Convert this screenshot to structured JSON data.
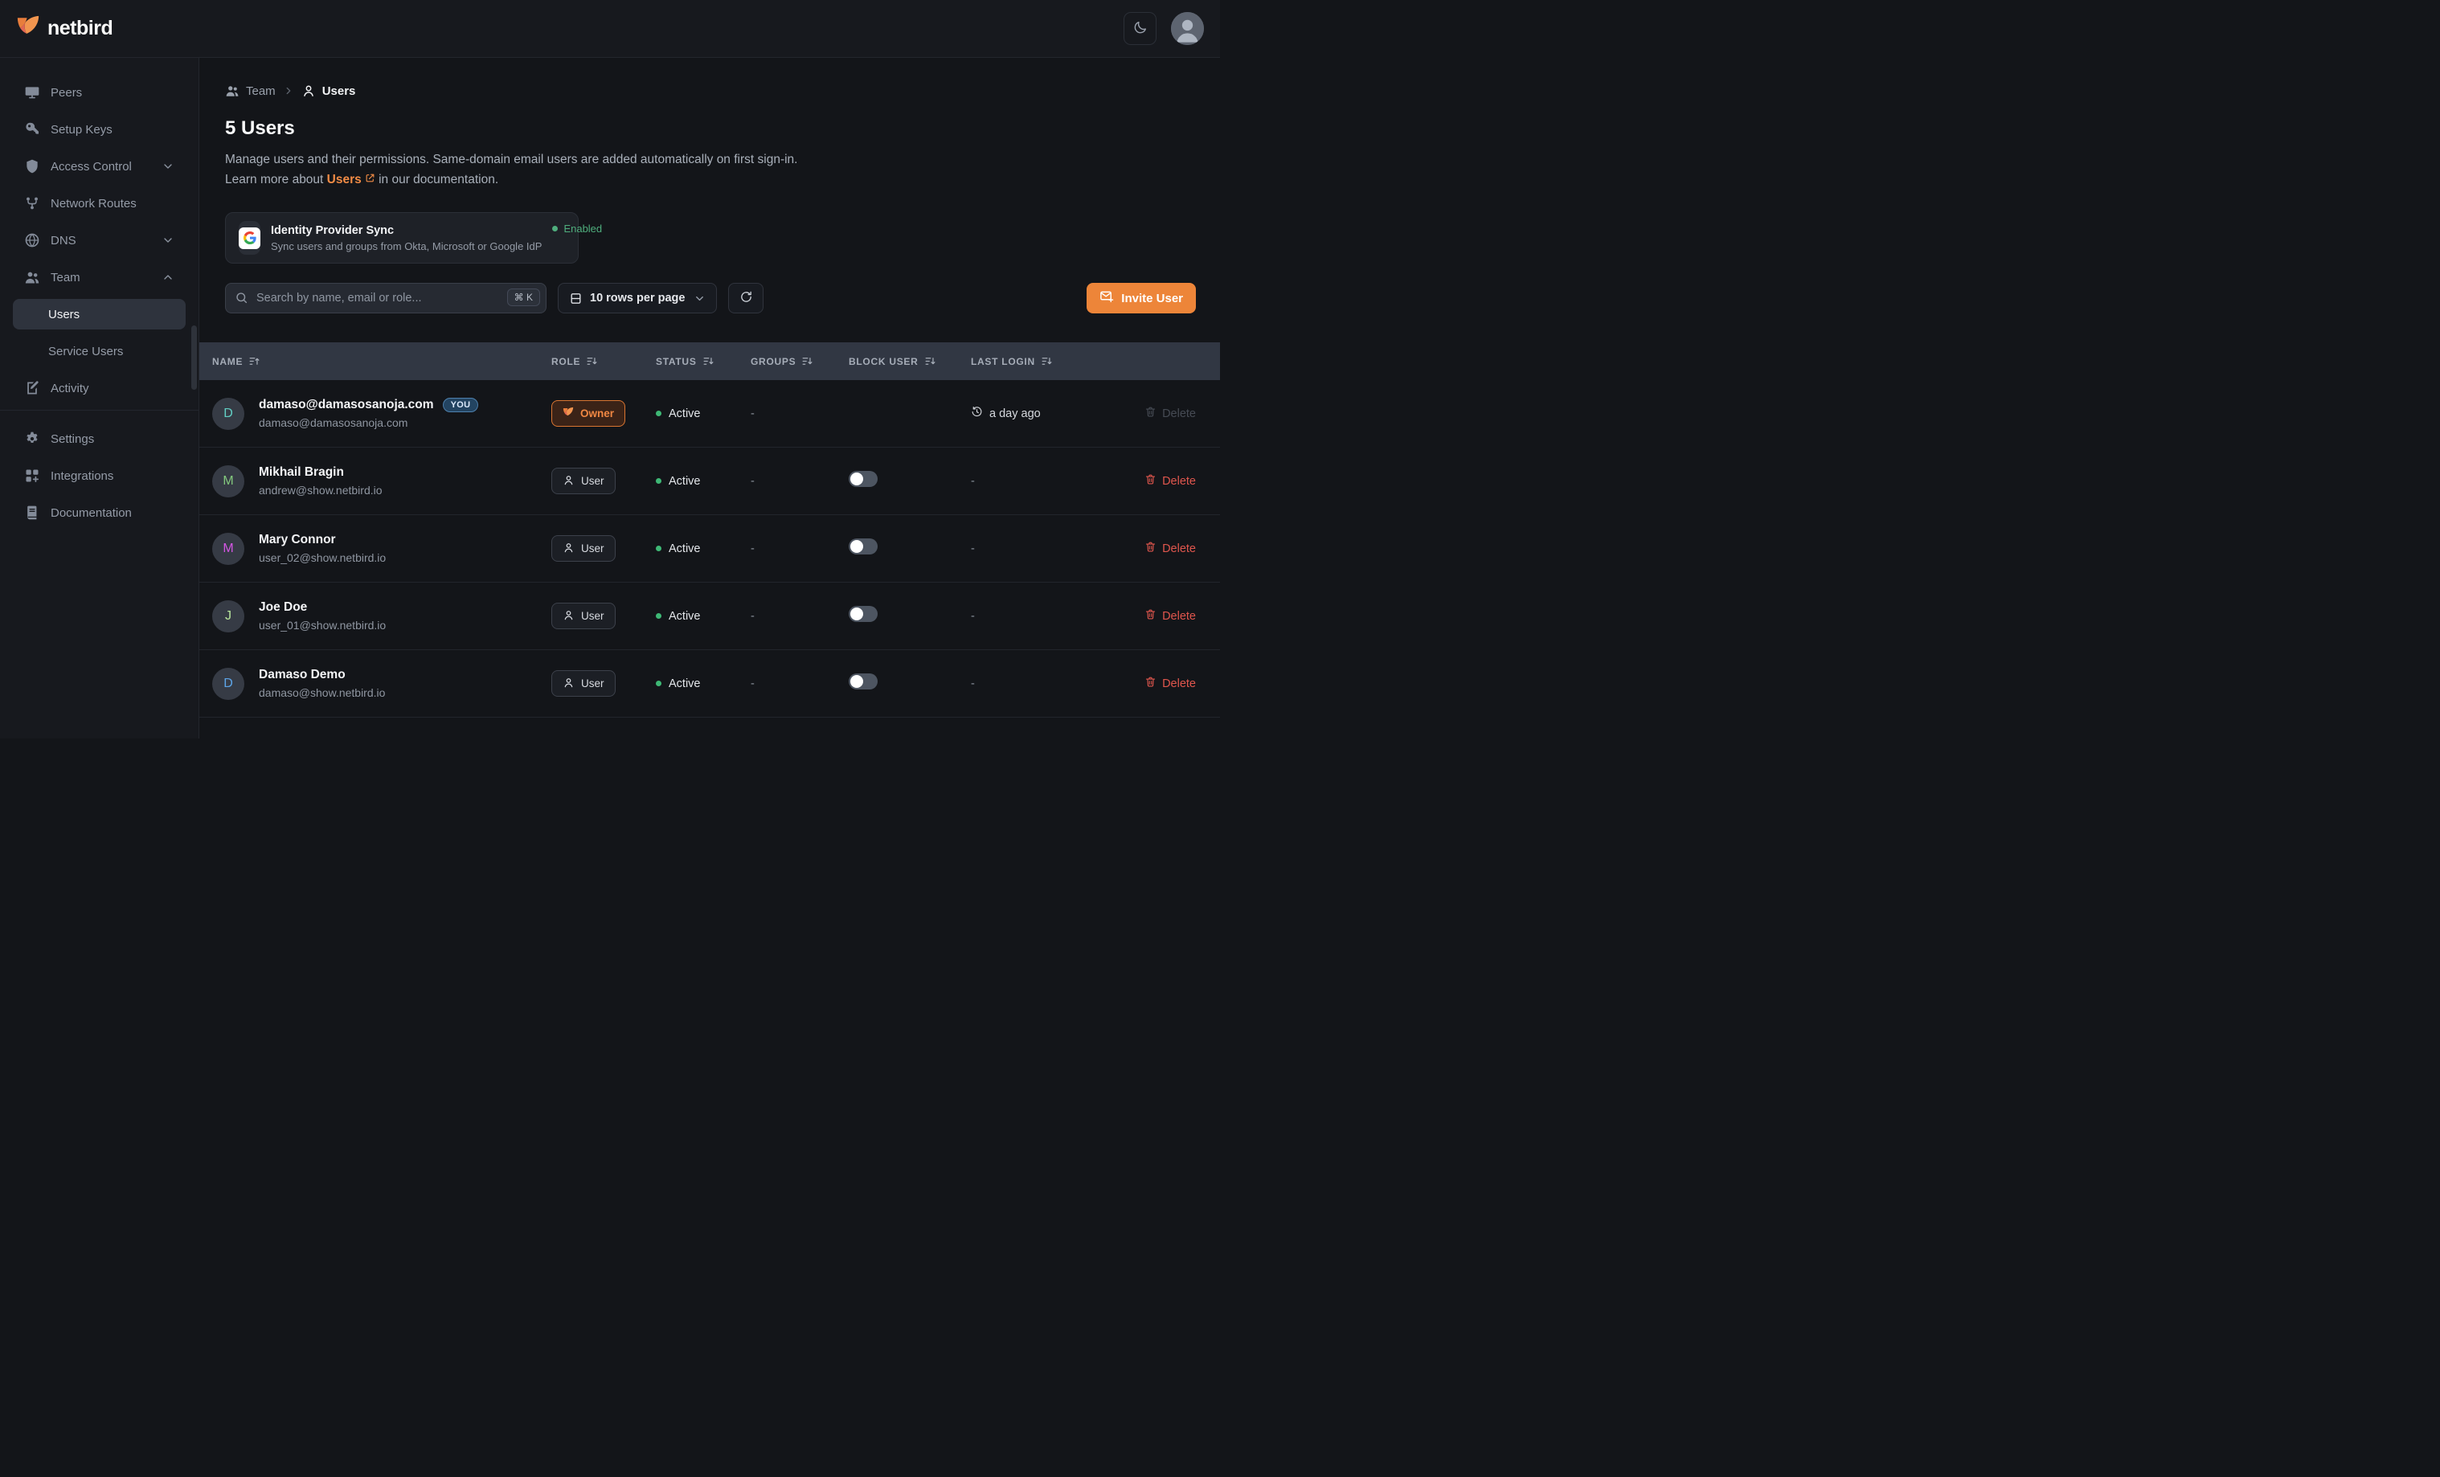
{
  "header": {
    "brand": "netbird"
  },
  "colors": {
    "accent": "#ed8539",
    "green": "#3eb875",
    "danger": "#e0564d",
    "owner_orange": "#ef8743"
  },
  "sidebar": {
    "items": [
      {
        "label": "Peers",
        "icon": "monitor-icon"
      },
      {
        "label": "Setup Keys",
        "icon": "key-icon"
      },
      {
        "label": "Access Control",
        "icon": "shield-icon",
        "chevron": "down"
      },
      {
        "label": "Network Routes",
        "icon": "routes-icon"
      },
      {
        "label": "DNS",
        "icon": "globe-icon",
        "chevron": "down"
      },
      {
        "label": "Team",
        "icon": "team-icon",
        "chevron": "up",
        "children": [
          {
            "label": "Users",
            "active": true
          },
          {
            "label": "Service Users",
            "active": false
          }
        ]
      },
      {
        "label": "Activity",
        "icon": "activity-icon"
      }
    ],
    "footer_items": [
      {
        "label": "Settings",
        "icon": "gear-icon"
      },
      {
        "label": "Integrations",
        "icon": "integrations-icon"
      },
      {
        "label": "Documentation",
        "icon": "docs-icon"
      }
    ]
  },
  "breadcrumb": {
    "team": "Team",
    "users": "Users"
  },
  "page": {
    "title": "5 Users",
    "description": "Manage users and their permissions. Same-domain email users are added automatically on first sign-in.",
    "learn_prefix": "Learn more about",
    "learn_link": "Users",
    "learn_suffix": "in our documentation."
  },
  "idp_card": {
    "title": "Identity Provider Sync",
    "subtitle": "Sync users and groups from Okta, Microsoft or Google IdP",
    "status": "Enabled"
  },
  "controls": {
    "search_placeholder": "Search by name, email or role...",
    "shortcut": "⌘ K",
    "rows_per_page": "10 rows per page",
    "invite": "Invite User"
  },
  "table": {
    "columns": [
      {
        "label": "NAME",
        "sort": "up"
      },
      {
        "label": "ROLE",
        "sort": "down"
      },
      {
        "label": "STATUS",
        "sort": "down"
      },
      {
        "label": "GROUPS",
        "sort": "down"
      },
      {
        "label": "BLOCK USER",
        "sort": "down"
      },
      {
        "label": "LAST LOGIN",
        "sort": "down"
      }
    ],
    "rows": [
      {
        "initial": "D",
        "initial_color": "#62cfc4",
        "name": "damaso@damasosanoja.com",
        "you_badge": "YOU",
        "email": "damaso@damasosanoja.com",
        "role": "Owner",
        "role_variant": "owner",
        "status": "Active",
        "groups": "-",
        "has_toggle": false,
        "last_login": "a day ago",
        "last_login_icon": true,
        "delete_label": "Delete",
        "delete_disabled": true
      },
      {
        "initial": "M",
        "initial_color": "#83c87d",
        "name": "Mikhail Bragin",
        "you_badge": null,
        "email": "andrew@show.netbird.io",
        "role": "User",
        "role_variant": "user",
        "status": "Active",
        "groups": "-",
        "has_toggle": true,
        "last_login": "-",
        "last_login_icon": false,
        "delete_label": "Delete",
        "delete_disabled": false
      },
      {
        "initial": "M",
        "initial_color": "#d356e3",
        "name": "Mary Connor",
        "you_badge": null,
        "email": "user_02@show.netbird.io",
        "role": "User",
        "role_variant": "user",
        "status": "Active",
        "groups": "-",
        "has_toggle": true,
        "last_login": "-",
        "last_login_icon": false,
        "delete_label": "Delete",
        "delete_disabled": false
      },
      {
        "initial": "J",
        "initial_color": "#b8e59c",
        "name": "Joe Doe",
        "you_badge": null,
        "email": "user_01@show.netbird.io",
        "role": "User",
        "role_variant": "user",
        "status": "Active",
        "groups": "-",
        "has_toggle": true,
        "last_login": "-",
        "last_login_icon": false,
        "delete_label": "Delete",
        "delete_disabled": false
      },
      {
        "initial": "D",
        "initial_color": "#5da5e8",
        "name": "Damaso Demo",
        "you_badge": null,
        "email": "damaso@show.netbird.io",
        "role": "User",
        "role_variant": "user",
        "status": "Active",
        "groups": "-",
        "has_toggle": true,
        "last_login": "-",
        "last_login_icon": false,
        "delete_label": "Delete",
        "delete_disabled": false
      }
    ]
  }
}
